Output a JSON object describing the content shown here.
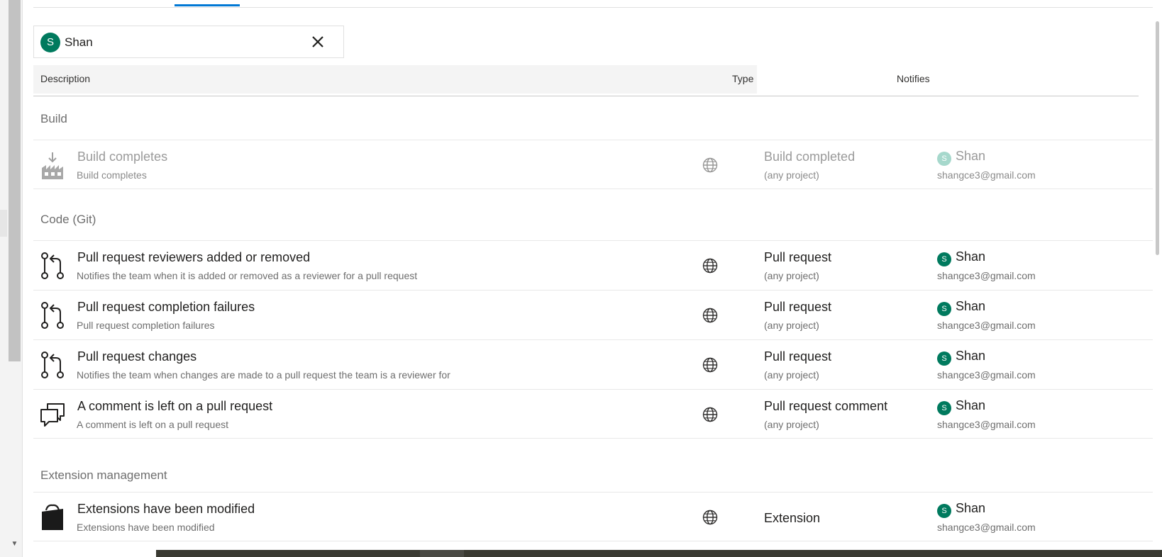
{
  "filter": {
    "avatar_initial": "S",
    "name": "Shan"
  },
  "columns": {
    "description": "Description",
    "type": "Type",
    "notifies": "Notifies"
  },
  "groups": [
    {
      "title": "Build",
      "rows": [
        {
          "title": "Build completes",
          "subtitle": "Build completes",
          "type": "Build completed",
          "type_sub": "(any project)",
          "notify_initial": "S",
          "notify_name": "Shan",
          "notify_email": "shangce3@gmail.com",
          "icon": "build-icon",
          "disabled": true
        }
      ]
    },
    {
      "title": "Code (Git)",
      "rows": [
        {
          "title": "Pull request reviewers added or removed",
          "subtitle": "Notifies the team when it is added or removed as a reviewer for a pull request",
          "type": "Pull request",
          "type_sub": "(any project)",
          "notify_initial": "S",
          "notify_name": "Shan",
          "notify_email": "shangce3@gmail.com",
          "icon": "pull-request-icon"
        },
        {
          "title": "Pull request completion failures",
          "subtitle": "Pull request completion failures",
          "type": "Pull request",
          "type_sub": "(any project)",
          "notify_initial": "S",
          "notify_name": "Shan",
          "notify_email": "shangce3@gmail.com",
          "icon": "pull-request-icon"
        },
        {
          "title": "Pull request changes",
          "subtitle": "Notifies the team when changes are made to a pull request the team is a reviewer for",
          "type": "Pull request",
          "type_sub": "(any project)",
          "notify_initial": "S",
          "notify_name": "Shan",
          "notify_email": "shangce3@gmail.com",
          "icon": "pull-request-icon"
        },
        {
          "title": "A comment is left on a pull request",
          "subtitle": "A comment is left on a pull request",
          "type": "Pull request comment",
          "type_sub": "(any project)",
          "notify_initial": "S",
          "notify_name": "Shan",
          "notify_email": "shangce3@gmail.com",
          "icon": "comment-icon"
        }
      ]
    },
    {
      "title": "Extension management",
      "rows": [
        {
          "title": "Extensions have been modified",
          "subtitle": "Extensions have been modified",
          "type": "Extension",
          "notify_initial": "S",
          "notify_name": "Shan",
          "notify_email": "shangce3@gmail.com",
          "icon": "extension-bag-icon"
        }
      ]
    }
  ],
  "colors": {
    "accent": "#0078d4",
    "avatar": "#007a5e",
    "avatar_disabled": "#a6d8cc"
  }
}
